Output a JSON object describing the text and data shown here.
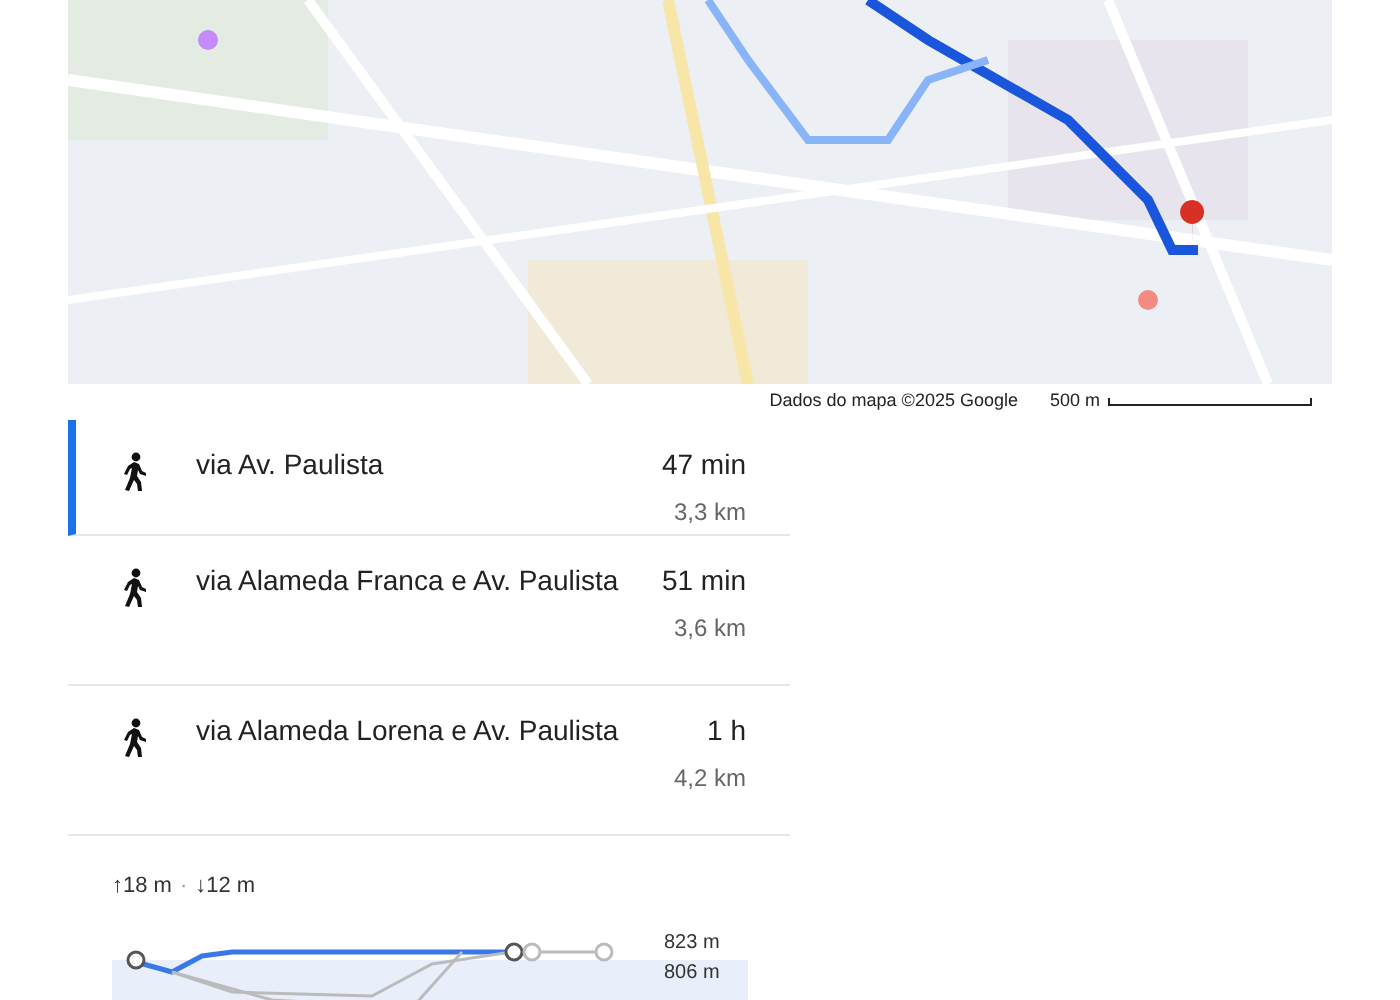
{
  "map": {
    "attribution": "Dados do mapa ©2025 Google",
    "scale": "500 m"
  },
  "routes": [
    {
      "label": "via Av. Paulista",
      "duration": "47 min",
      "distance": "3,3 km",
      "selected": true
    },
    {
      "label": "via Alameda Franca e Av. Paulista",
      "duration": "51 min",
      "distance": "3,6 km",
      "selected": false
    },
    {
      "label": "via Alameda Lorena e Av. Paulista",
      "duration": "1 h",
      "distance": "4,2 km",
      "selected": false
    }
  ],
  "elevation": {
    "ascent": "↑18 m",
    "descent": "↓12 m",
    "separator": "·",
    "max_label": "823 m",
    "min_label": "806 m"
  }
}
